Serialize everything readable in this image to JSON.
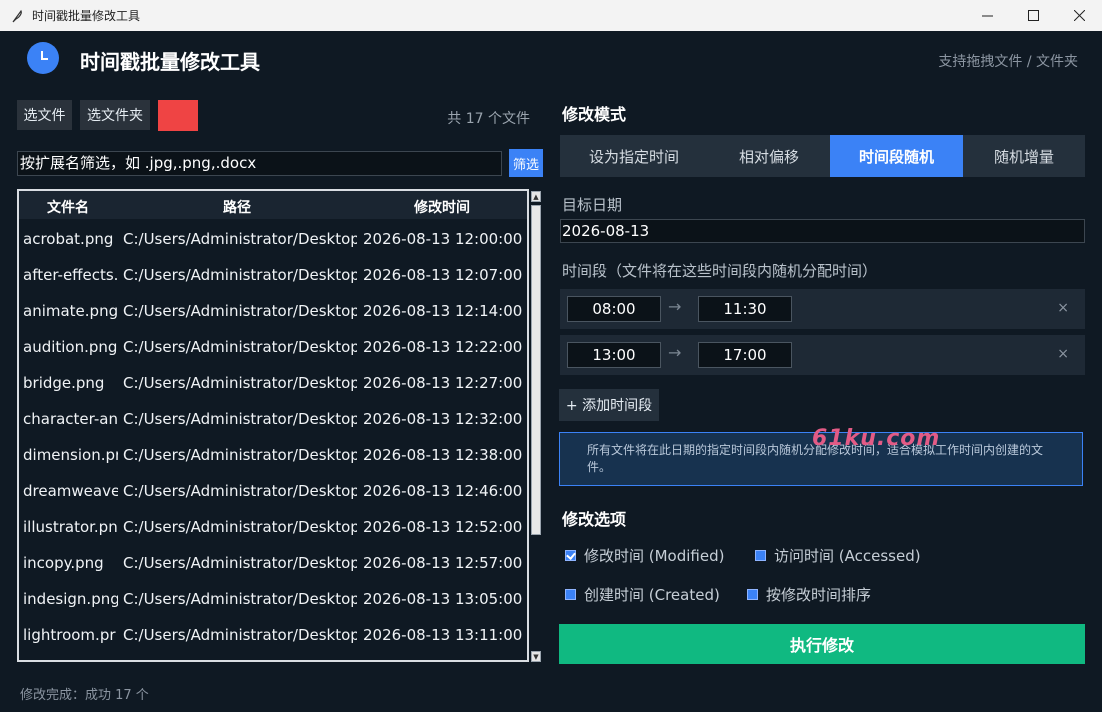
{
  "window": {
    "title": "时间戳批量修改工具"
  },
  "header": {
    "title": "时间戳批量修改工具",
    "hint": "支持拖拽文件 / 文件夹"
  },
  "toolbar": {
    "select_files": "选文件",
    "select_folder": "选文件夹",
    "file_count": "共 17 个文件"
  },
  "filter": {
    "value": "按扩展名筛选，如 .jpg,.png,.docx",
    "button": "筛选"
  },
  "table": {
    "headers": {
      "name": "文件名",
      "path": "路径",
      "mtime": "修改时间"
    },
    "rows": [
      {
        "name": "acrobat.png",
        "path": "C:/Users/Administrator/Desktop",
        "mtime": "2026-08-13 12:00:00"
      },
      {
        "name": "after-effects.",
        "path": "C:/Users/Administrator/Desktop",
        "mtime": "2026-08-13 12:07:00"
      },
      {
        "name": "animate.png",
        "path": "C:/Users/Administrator/Desktop",
        "mtime": "2026-08-13 12:14:00"
      },
      {
        "name": "audition.png",
        "path": "C:/Users/Administrator/Desktop",
        "mtime": "2026-08-13 12:22:00"
      },
      {
        "name": "bridge.png",
        "path": "C:/Users/Administrator/Desktop",
        "mtime": "2026-08-13 12:27:00"
      },
      {
        "name": "character-an",
        "path": "C:/Users/Administrator/Desktop",
        "mtime": "2026-08-13 12:32:00"
      },
      {
        "name": "dimension.pr",
        "path": "C:/Users/Administrator/Desktop",
        "mtime": "2026-08-13 12:38:00"
      },
      {
        "name": "dreamweave",
        "path": "C:/Users/Administrator/Desktop",
        "mtime": "2026-08-13 12:46:00"
      },
      {
        "name": "illustrator.pn",
        "path": "C:/Users/Administrator/Desktop",
        "mtime": "2026-08-13 12:52:00"
      },
      {
        "name": "incopy.png",
        "path": "C:/Users/Administrator/Desktop",
        "mtime": "2026-08-13 12:57:00"
      },
      {
        "name": "indesign.png",
        "path": "C:/Users/Administrator/Desktop",
        "mtime": "2026-08-13 13:05:00"
      },
      {
        "name": "lightroom.pr",
        "path": "C:/Users/Administrator/Desktop",
        "mtime": "2026-08-13 13:11:00"
      }
    ]
  },
  "status": "修改完成：成功 17 个",
  "mode": {
    "title": "修改模式",
    "tabs": [
      "设为指定时间",
      "相对偏移",
      "时间段随机",
      "随机增量"
    ],
    "active_tab": "时间段随机"
  },
  "target_date": {
    "label": "目标日期",
    "value": "2026-08-13"
  },
  "ranges": {
    "label": "时间段（文件将在这些时间段内随机分配时间）",
    "items": [
      {
        "start": "08:00",
        "end": "11:30"
      },
      {
        "start": "13:00",
        "end": "17:00"
      }
    ],
    "arrow": "→",
    "remove": "×",
    "add_button": "+ 添加时间段"
  },
  "info": "所有文件将在此日期的指定时间段内随机分配修改时间，适合模拟工作时间内创建的文件。",
  "watermark": "61ku.com",
  "options": {
    "title": "修改选项",
    "modified": "修改时间 (Modified)",
    "accessed": "访问时间 (Accessed)",
    "created": "创建时间 (Created)",
    "sort": "按修改时间排序"
  },
  "execute_button": "执行修改",
  "colors": {
    "background": "#0f1923",
    "accent": "#3b82f6",
    "success": "#10b981",
    "danger": "#ef4444"
  }
}
